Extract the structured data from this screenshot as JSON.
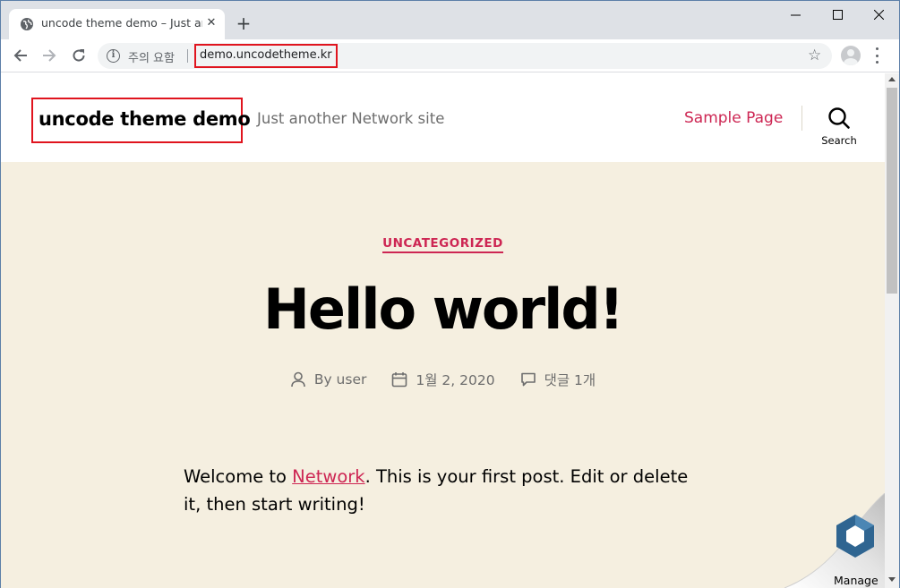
{
  "browser": {
    "tab_title": "uncode theme demo – Just another",
    "new_tab_label": "+",
    "security_text": "주의 요함",
    "url": "demo.uncodetheme.kr"
  },
  "site": {
    "title": "uncode theme demo",
    "tagline": "Just another Network site",
    "nav": [
      {
        "label": "Sample Page"
      }
    ],
    "search_label": "Search"
  },
  "post": {
    "category": "UNCATEGORIZED",
    "title": "Hello world!",
    "meta": {
      "author": "By user",
      "date": "1월 2, 2020",
      "comments": "댓글 1개"
    },
    "body": {
      "before_link": "Welcome to ",
      "link_text": "Network",
      "after_link": ". This is your first post. Edit or delete it, then start writing!"
    }
  },
  "widget": {
    "manage_label": "Manage"
  },
  "colors": {
    "accent": "#cd2653",
    "hero_bg": "#f5efe0",
    "highlight_box": "#e0141e"
  }
}
